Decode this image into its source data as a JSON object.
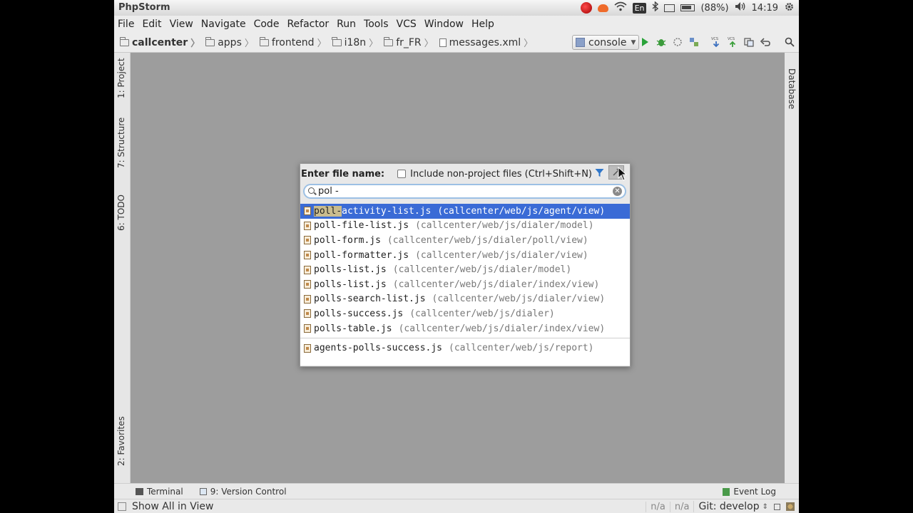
{
  "os_panel": {
    "app_name": "PhpStorm",
    "keyboard_layout": "En",
    "battery": "(88%)",
    "clock": "14:19"
  },
  "menu": [
    {
      "label": "File"
    },
    {
      "label": "Edit"
    },
    {
      "label": "View"
    },
    {
      "label": "Navigate"
    },
    {
      "label": "Code"
    },
    {
      "label": "Refactor"
    },
    {
      "label": "Run"
    },
    {
      "label": "Tools"
    },
    {
      "label": "VCS"
    },
    {
      "label": "Window"
    },
    {
      "label": "Help"
    }
  ],
  "breadcrumbs": [
    {
      "label": "callcenter",
      "type": "folder"
    },
    {
      "label": "apps",
      "type": "folder"
    },
    {
      "label": "frontend",
      "type": "folder"
    },
    {
      "label": "i18n",
      "type": "folder"
    },
    {
      "label": "fr_FR",
      "type": "folder"
    },
    {
      "label": "messages.xml",
      "type": "file"
    }
  ],
  "run_config": "console",
  "left_tabs": [
    {
      "label": "1: Project"
    },
    {
      "label": "7: Structure"
    },
    {
      "label": "6: TODO"
    },
    {
      "label": "2: Favorites"
    }
  ],
  "right_tabs": [
    {
      "label": "Database"
    }
  ],
  "bottom_tools": {
    "terminal": "Terminal",
    "version_control": "9: Version Control",
    "event_log": "Event Log"
  },
  "status_bar": {
    "text": "Show All in View",
    "pos1": "n/a",
    "pos2": "n/a",
    "git": "Git: develop"
  },
  "popup": {
    "title": "Enter file name:",
    "include_label": "Include non-project files (Ctrl+Shift+N)",
    "search_value": "pol -",
    "results": [
      {
        "highlight": "poll",
        "gap": "-",
        "name_rest": "activity-list.js",
        "path": "(callcenter/web/js/agent/view)",
        "selected": true
      },
      {
        "name": "poll-file-list.js",
        "path": "(callcenter/web/js/dialer/model)"
      },
      {
        "name": "poll-form.js",
        "path": "(callcenter/web/js/dialer/poll/view)"
      },
      {
        "name": "poll-formatter.js",
        "path": "(callcenter/web/js/dialer/view)"
      },
      {
        "name": "polls-list.js",
        "path": "(callcenter/web/js/dialer/model)"
      },
      {
        "name": "polls-list.js",
        "path": "(callcenter/web/js/dialer/index/view)"
      },
      {
        "name": "polls-search-list.js",
        "path": "(callcenter/web/js/dialer/view)"
      },
      {
        "name": "polls-success.js",
        "path": "(callcenter/web/js/dialer)"
      },
      {
        "name": "polls-table.js",
        "path": "(callcenter/web/js/dialer/index/view)"
      }
    ],
    "extra_results": [
      {
        "name": "agents-polls-success.js",
        "path": "(callcenter/web/js/report)"
      }
    ]
  }
}
